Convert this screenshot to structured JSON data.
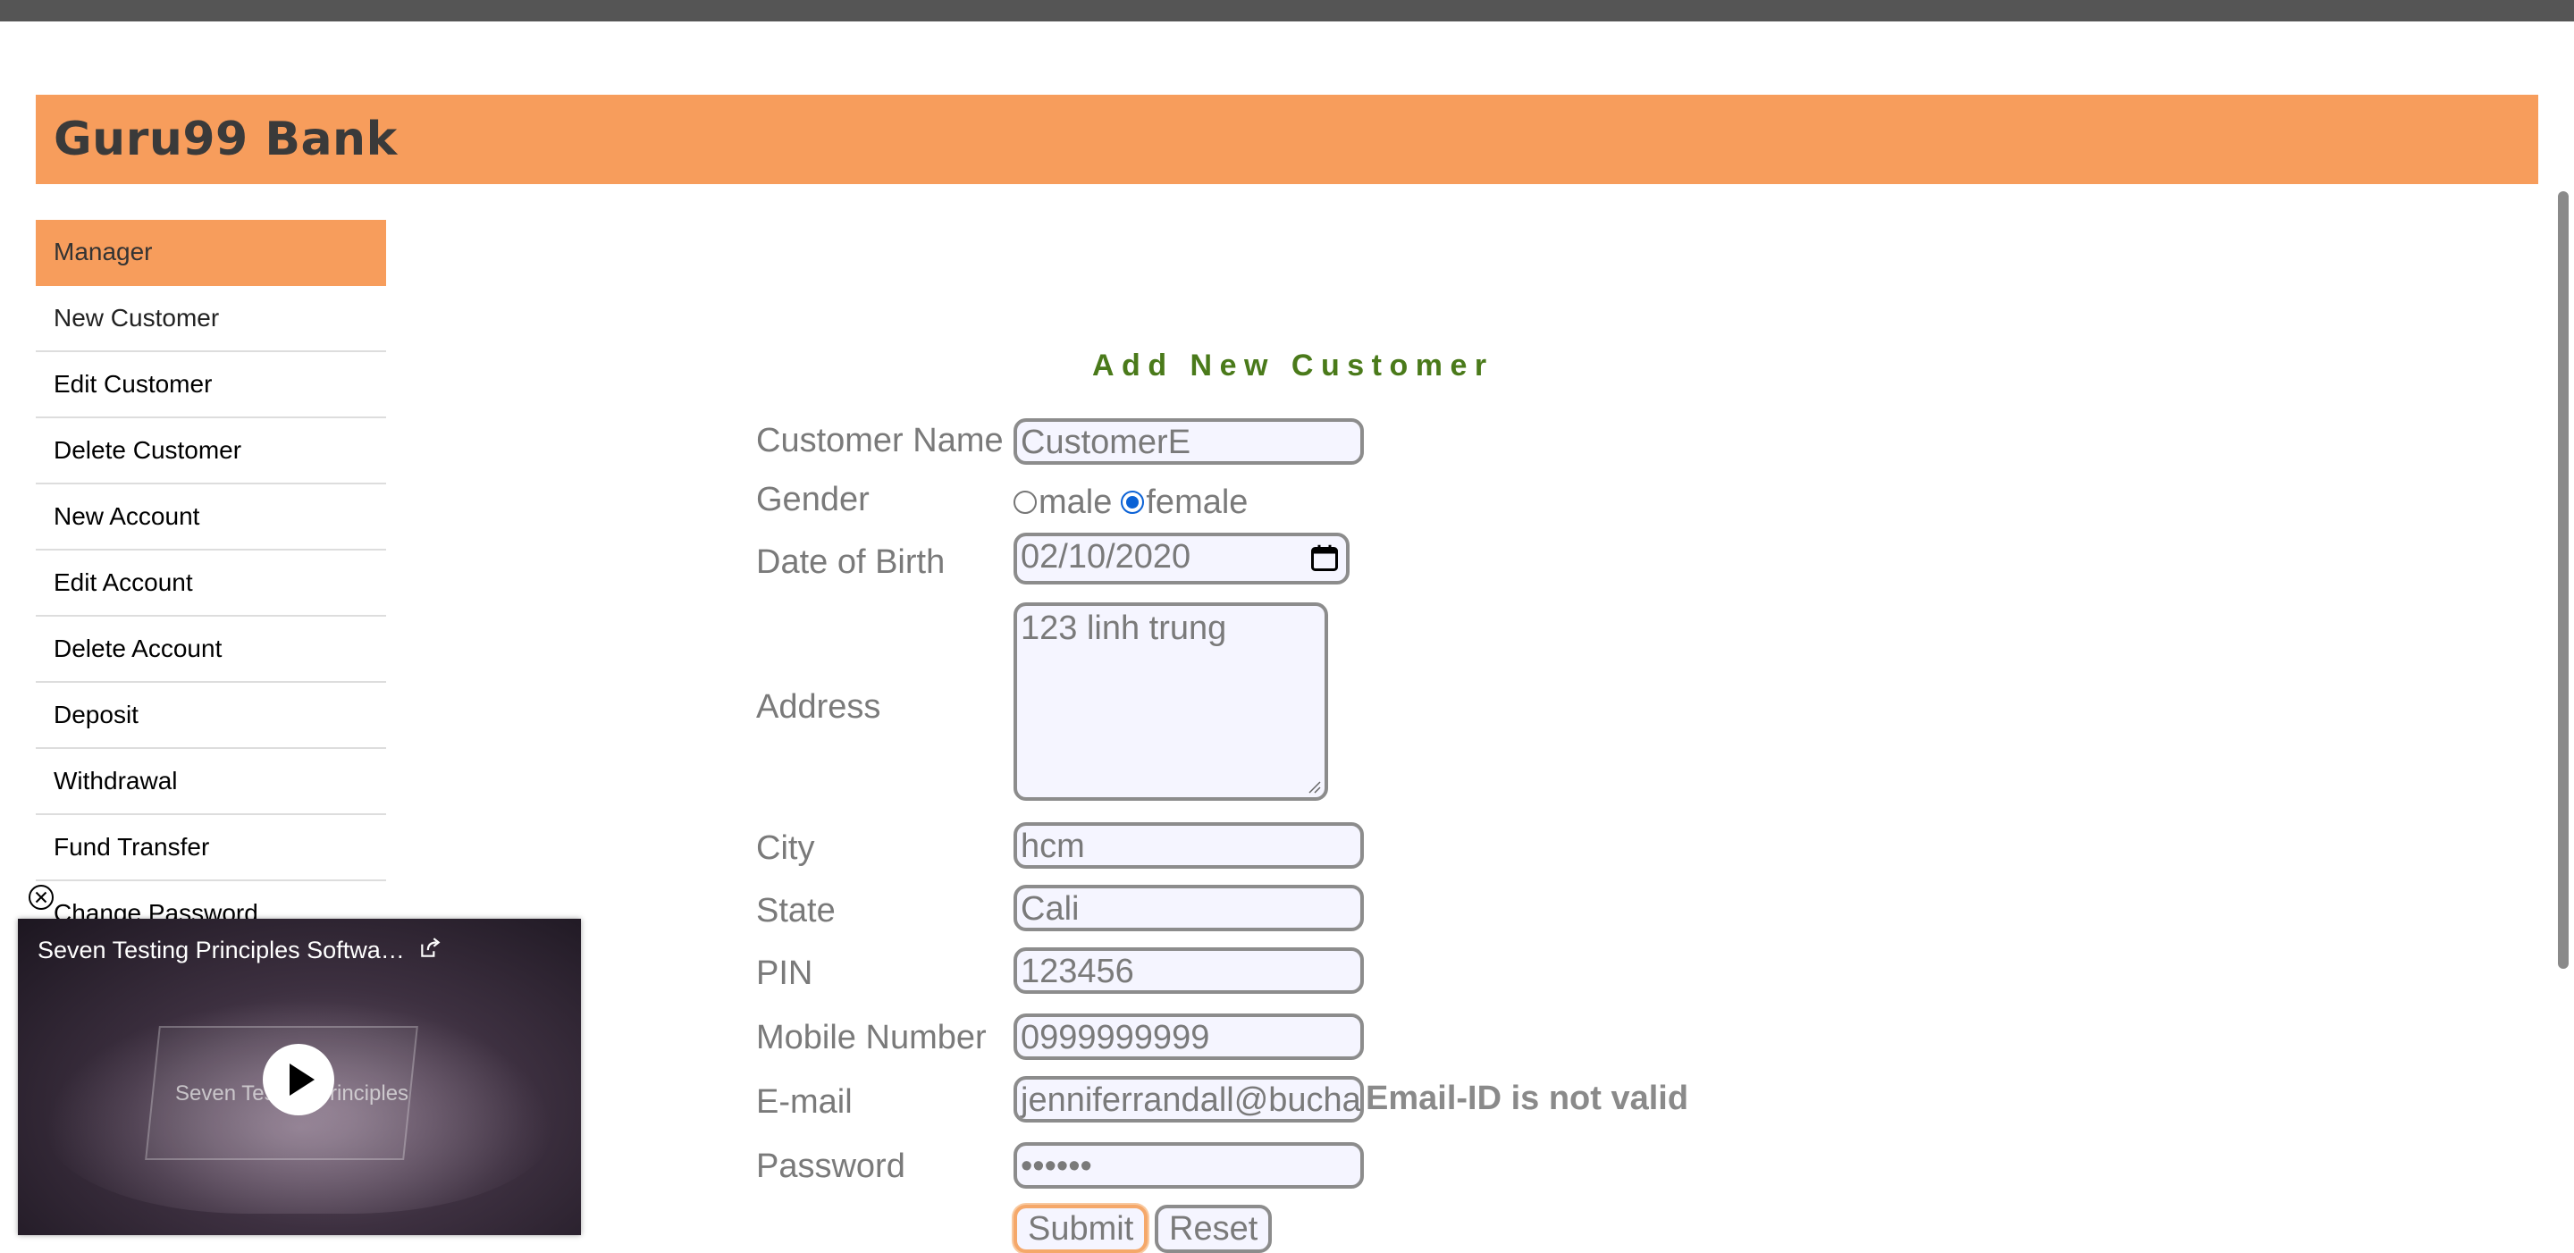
{
  "app": {
    "title": "Guru99 Bank"
  },
  "sidebar": {
    "items": [
      {
        "label": "Manager"
      },
      {
        "label": "New Customer"
      },
      {
        "label": "Edit Customer"
      },
      {
        "label": "Delete Customer"
      },
      {
        "label": "New Account"
      },
      {
        "label": "Edit Account"
      },
      {
        "label": "Delete Account"
      },
      {
        "label": "Deposit"
      },
      {
        "label": "Withdrawal"
      },
      {
        "label": "Fund Transfer"
      },
      {
        "label": "Change Password"
      }
    ]
  },
  "form": {
    "title": "Add New Customer",
    "labels": {
      "customer_name": "Customer Name",
      "gender": "Gender",
      "dob": "Date of Birth",
      "address": "Address",
      "city": "City",
      "state": "State",
      "pin": "PIN",
      "mobile": "Mobile Number",
      "email": "E-mail",
      "password": "Password"
    },
    "values": {
      "customer_name": "CustomerE",
      "gender_selected": "female",
      "dob": "02/10/2020",
      "address": "123 linh trung",
      "city": "hcm",
      "state": "Cali",
      "pin": "123456",
      "mobile": "0999999999",
      "email": "jenniferrandall@bucha",
      "password": "••••••"
    },
    "gender_options": {
      "male": "male",
      "female": "female"
    },
    "email_error": "Email-ID is not valid",
    "buttons": {
      "submit": "Submit",
      "reset": "Reset"
    }
  },
  "video": {
    "title": "Seven Testing Principles Softwa…",
    "overlay_text": "Seven Testing Principles"
  },
  "colors": {
    "brand_orange": "#f79d5c",
    "title_green": "#4a7a1a",
    "radio_blue": "#0b62d6"
  }
}
